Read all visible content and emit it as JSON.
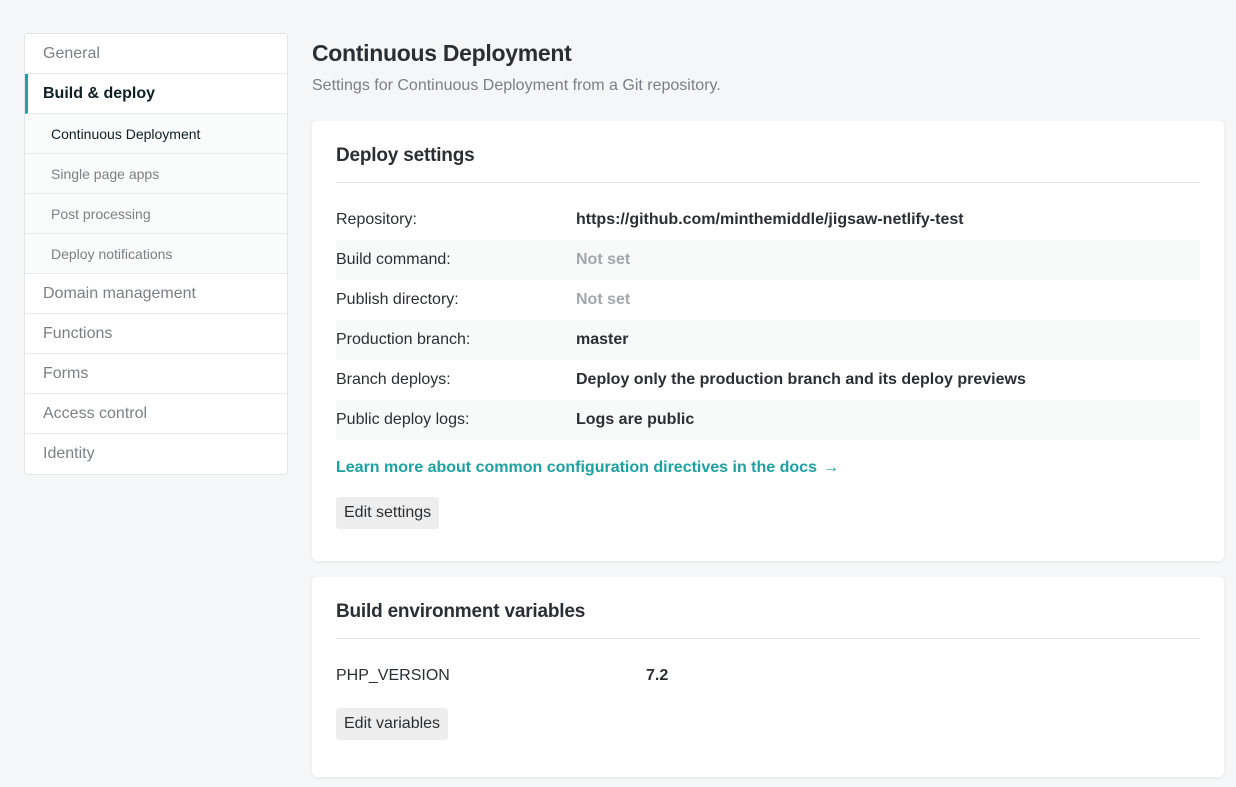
{
  "sidebar": {
    "items": [
      {
        "label": "General"
      },
      {
        "label": "Build & deploy"
      },
      {
        "label": "Continuous Deployment"
      },
      {
        "label": "Single page apps"
      },
      {
        "label": "Post processing"
      },
      {
        "label": "Deploy notifications"
      },
      {
        "label": "Domain management"
      },
      {
        "label": "Functions"
      },
      {
        "label": "Forms"
      },
      {
        "label": "Access control"
      },
      {
        "label": "Identity"
      }
    ]
  },
  "page": {
    "title": "Continuous Deployment",
    "subtitle": "Settings for Continuous Deployment from a Git repository."
  },
  "deploy_settings": {
    "title": "Deploy settings",
    "rows": [
      {
        "label": "Repository:",
        "value": "https://github.com/minthemiddle/jigsaw-netlify-test"
      },
      {
        "label": "Build command:",
        "value": "Not set"
      },
      {
        "label": "Publish directory:",
        "value": "Not set"
      },
      {
        "label": "Production branch:",
        "value": "master"
      },
      {
        "label": "Branch deploys:",
        "value": "Deploy only the production branch and its deploy previews"
      },
      {
        "label": "Public deploy logs:",
        "value": "Logs are public"
      }
    ],
    "docs_link": "Learn more about common configuration directives in the docs",
    "edit_button": "Edit settings"
  },
  "env_vars": {
    "title": "Build environment variables",
    "rows": [
      {
        "key": "PHP_VERSION",
        "value": "7.2"
      }
    ],
    "edit_button": "Edit variables"
  },
  "colors": {
    "accent": "#1da1a1",
    "background": "#f4f6f7",
    "muted_text": "#a2a7ab"
  },
  "icons": {
    "docs_link_arrow": "arrow-right-icon"
  }
}
